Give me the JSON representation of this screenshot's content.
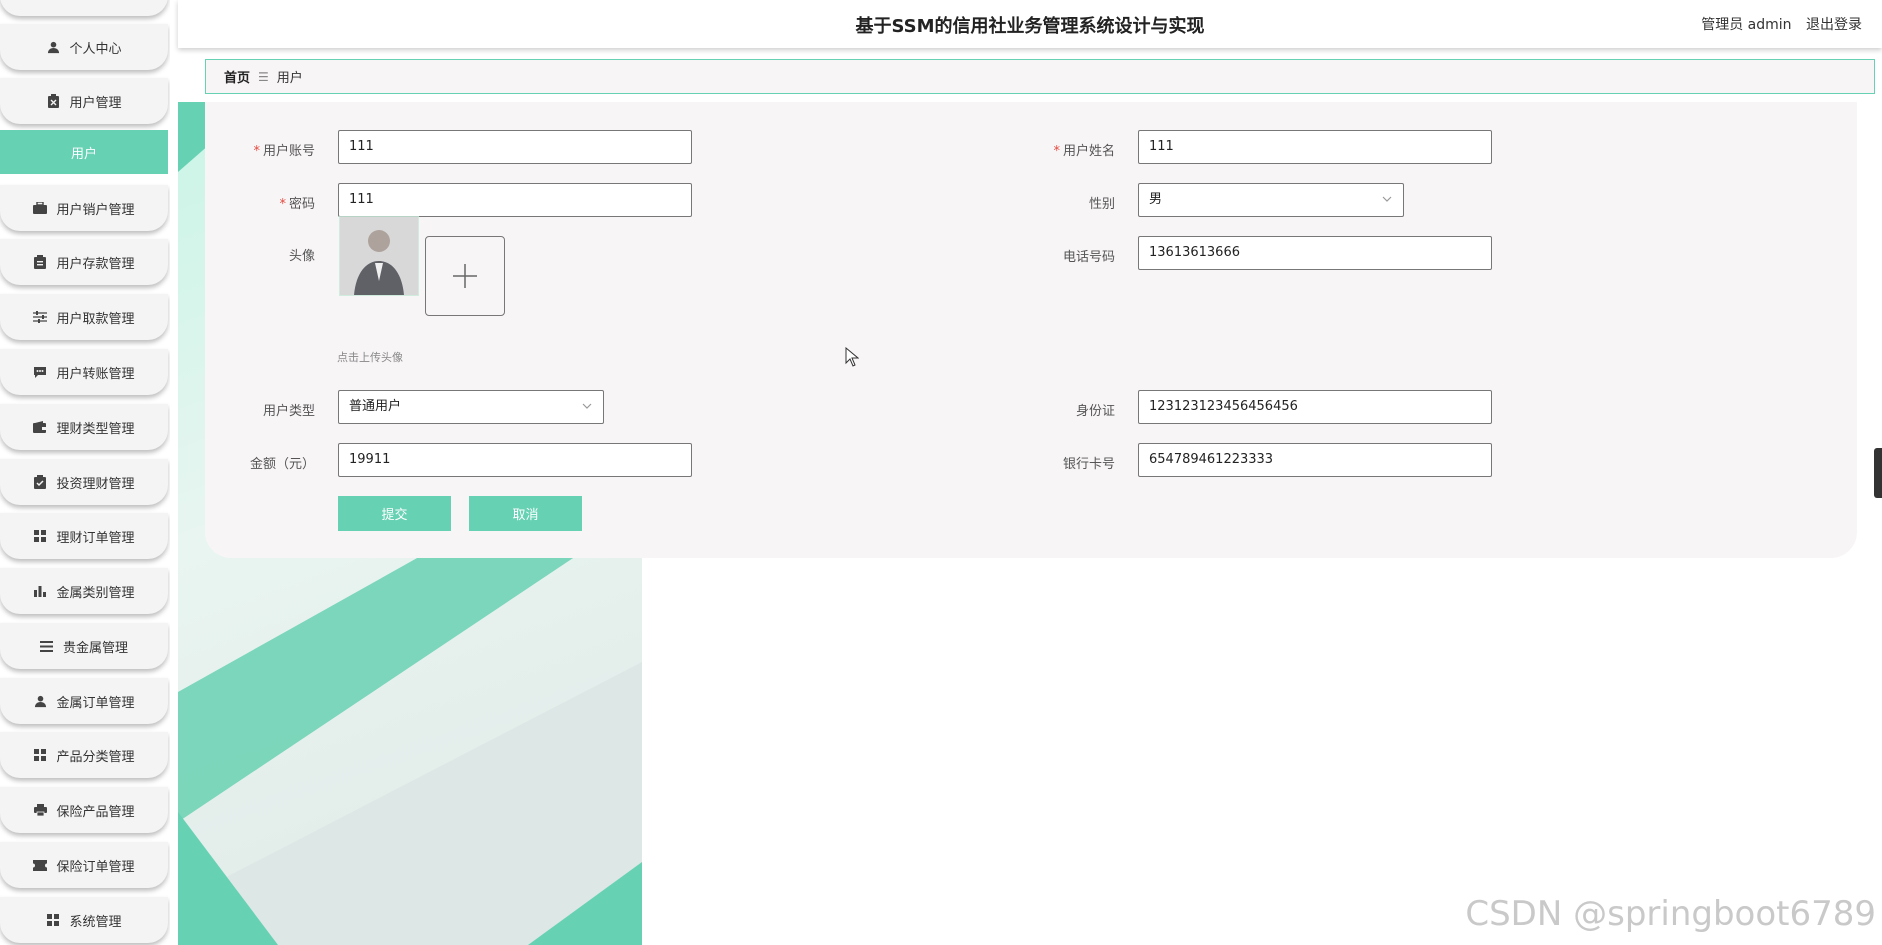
{
  "header": {
    "title": "基于SSM的信用社业务管理系统设计与实现",
    "user_label": "管理员 admin",
    "logout_label": "退出登录"
  },
  "sidebar": {
    "items": [
      {
        "label": "个人中心",
        "icon": "person-icon"
      },
      {
        "label": "用户管理",
        "icon": "clipboard-x-icon"
      },
      {
        "label": "用户",
        "icon": "",
        "active": true
      },
      {
        "label": "用户销户管理",
        "icon": "briefcase-icon"
      },
      {
        "label": "用户存款管理",
        "icon": "clipboard-icon"
      },
      {
        "label": "用户取款管理",
        "icon": "sliders-icon"
      },
      {
        "label": "用户转账管理",
        "icon": "chat-icon"
      },
      {
        "label": "理财类型管理",
        "icon": "wallet-icon"
      },
      {
        "label": "投资理财管理",
        "icon": "clipboard-check-icon"
      },
      {
        "label": "理财订单管理",
        "icon": "grid-icon"
      },
      {
        "label": "金属类别管理",
        "icon": "bar-chart-icon"
      },
      {
        "label": "贵金属管理",
        "icon": "list-icon"
      },
      {
        "label": "金属订单管理",
        "icon": "person-icon"
      },
      {
        "label": "产品分类管理",
        "icon": "grid-icon"
      },
      {
        "label": "保险产品管理",
        "icon": "printer-icon"
      },
      {
        "label": "保险订单管理",
        "icon": "ticket-icon"
      },
      {
        "label": "系统管理",
        "icon": "grid-icon"
      }
    ]
  },
  "breadcrumb": {
    "home": "首页",
    "separator": "☰",
    "current": "用户"
  },
  "form": {
    "account": {
      "label": "用户账号",
      "value": "111",
      "required": "*"
    },
    "name": {
      "label": "用户姓名",
      "value": "111",
      "required": "*"
    },
    "password": {
      "label": "密码",
      "value": "111",
      "required": "*"
    },
    "gender": {
      "label": "性别",
      "value": "男"
    },
    "avatar": {
      "label": "头像",
      "hint": "点击上传头像"
    },
    "phone": {
      "label": "电话号码",
      "value": "13613613666"
    },
    "user_type": {
      "label": "用户类型",
      "value": "普通用户"
    },
    "id_card": {
      "label": "身份证",
      "value": "123123123456456456"
    },
    "amount": {
      "label": "金额（元）",
      "value": "19911"
    },
    "bank_card": {
      "label": "银行卡号",
      "value": "654789461223333"
    },
    "submit_label": "提交",
    "cancel_label": "取消"
  },
  "colors": {
    "accent": "#66d2b3",
    "required": "#e4493e",
    "card_bg": "#f8f5f7"
  },
  "watermark": "CSDN @springboot6789"
}
